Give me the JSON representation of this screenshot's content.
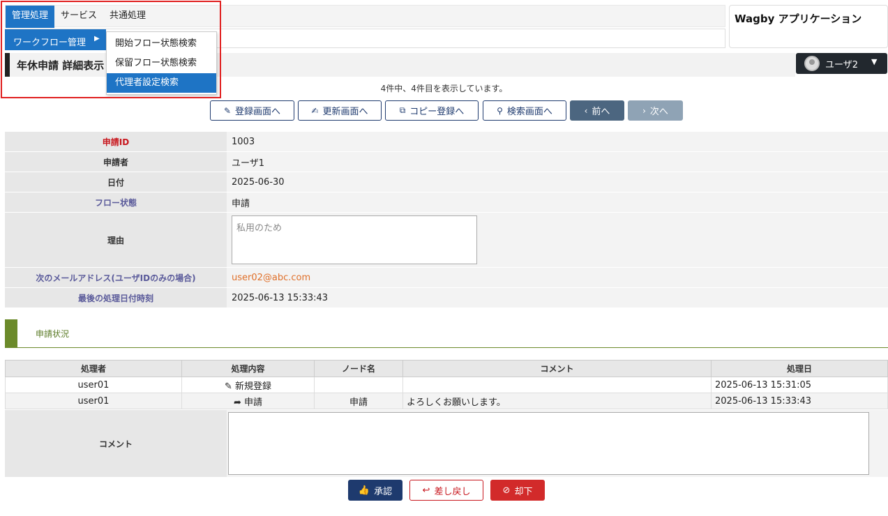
{
  "menu": {
    "items": [
      "管理処理",
      "サービス",
      "共通処理"
    ],
    "submenu_label": "ワークフロー管理",
    "submenu_items": [
      "開始フロー状態検索",
      "保留フロー状態検索",
      "代理者設定検索"
    ]
  },
  "brand": "Wagby アプリケーション",
  "page_title": "年休申請 詳細表示",
  "user": {
    "name": "ユーザ2"
  },
  "count_text": "4件中、4件目を表示しています。",
  "actions": {
    "register": "登録画面へ",
    "update": "更新画面へ",
    "copy": "コピー登録へ",
    "search": "検索画面へ",
    "prev": "前へ",
    "next": "次へ"
  },
  "details": [
    {
      "label": "申請ID",
      "value": "1003"
    },
    {
      "label": "申請者",
      "value": "ユーザ1"
    },
    {
      "label": "日付",
      "value": "2025-06-30"
    },
    {
      "label": "フロー状態",
      "value": "申請"
    },
    {
      "label": "理由",
      "value": "私用のため"
    },
    {
      "label": "次のメールアドレス(ユーザIDのみの場合)",
      "value": "user02@abc.com"
    },
    {
      "label": "最後の処理日付時刻",
      "value": "2025-06-13 15:33:43"
    }
  ],
  "section_title": "申請状況",
  "history": {
    "headers": [
      "処理者",
      "処理内容",
      "ノード名",
      "コメント",
      "処理日"
    ],
    "rows": [
      {
        "user": "user01",
        "action": "新規登録",
        "node": "",
        "comment": "",
        "date": "2025-06-13 15:31:05"
      },
      {
        "user": "user01",
        "action": "申請",
        "node": "申請",
        "comment": "よろしくお願いします。",
        "date": "2025-06-13 15:33:43"
      }
    ]
  },
  "comment_label": "コメント",
  "workflow": {
    "approve": "承認",
    "return": "差し戻し",
    "reject": "却下"
  },
  "colors": {
    "accent": "#1e74c5",
    "navy": "#1e3a6e",
    "danger": "#d22a2a",
    "section": "#6b8a2a",
    "highlight": "#e02020"
  }
}
